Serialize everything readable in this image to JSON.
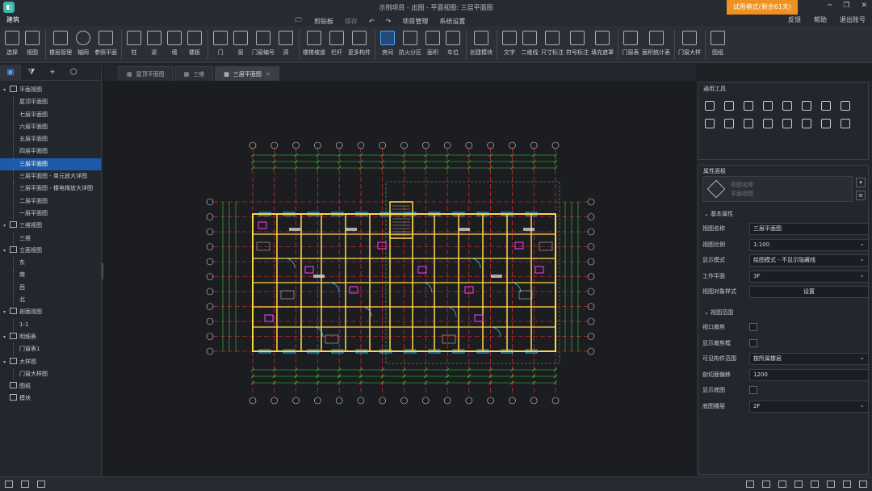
{
  "window": {
    "title": "示例项目 - 出图 - 平面视图: 三层平面图",
    "trial_label": "试用模式(剩余61天)",
    "minimize_glyph": "─",
    "maximize_glyph": "❐",
    "close_glyph": "✕"
  },
  "menu": {
    "module_tab": "建筑",
    "clipboard": "剪贴板",
    "save": "保存",
    "undo_glyph": "↶",
    "redo_glyph": "↷",
    "project_manage": "项目管理",
    "system_settings": "系统设置",
    "feedback": "反馈",
    "help": "帮助",
    "logout": "退出账号"
  },
  "ribbon": [
    {
      "label": "选择",
      "icon": "select-icon"
    },
    {
      "label": "视图",
      "icon": "view-icon"
    },
    {
      "label": "楼层管理",
      "icon": "floor-manage-icon"
    },
    {
      "label": "轴网",
      "icon": "axis-grid-icon"
    },
    {
      "label": "参照平面",
      "icon": "reference-plane-icon"
    },
    {
      "label": "柱",
      "icon": "column-icon"
    },
    {
      "label": "梁",
      "icon": "beam-icon"
    },
    {
      "label": "墙",
      "icon": "wall-icon"
    },
    {
      "label": "楼板",
      "icon": "slab-icon"
    },
    {
      "label": "门",
      "icon": "door-icon"
    },
    {
      "label": "窗",
      "icon": "window-icon"
    },
    {
      "label": "门窗编号",
      "icon": "door-window-number-icon"
    },
    {
      "label": "洞",
      "icon": "opening-icon"
    },
    {
      "label": "楼梯坡道",
      "icon": "stair-ramp-icon"
    },
    {
      "label": "栏杆",
      "icon": "railing-icon"
    },
    {
      "label": "更多构件",
      "icon": "more-components-icon"
    },
    {
      "label": "房间",
      "icon": "room-icon"
    },
    {
      "label": "防火分区",
      "icon": "fire-zone-icon"
    },
    {
      "label": "面积",
      "icon": "area-icon"
    },
    {
      "label": "车位",
      "icon": "parking-icon"
    },
    {
      "label": "创建模块",
      "icon": "create-module-icon"
    },
    {
      "label": "文字",
      "icon": "text-icon"
    },
    {
      "label": "二维线",
      "icon": "line-2d-icon"
    },
    {
      "label": "尺寸标注",
      "icon": "dimension-icon"
    },
    {
      "label": "符号标注",
      "icon": "symbol-icon"
    },
    {
      "label": "填充遮罩",
      "icon": "fill-mask-icon"
    },
    {
      "label": "门窗表",
      "icon": "door-window-table-icon"
    },
    {
      "label": "面积统计表",
      "icon": "area-table-icon"
    },
    {
      "label": "门窗大样",
      "icon": "door-window-detail-icon"
    },
    {
      "label": "图纸",
      "icon": "drawing-icon"
    }
  ],
  "left_panel": {
    "tree": [
      {
        "label": "平面视图",
        "level": 0,
        "expanded": true
      },
      {
        "label": "屋顶平面图",
        "level": 1
      },
      {
        "label": "七层平面图",
        "level": 1
      },
      {
        "label": "六层平面图",
        "level": 1
      },
      {
        "label": "五层平面图",
        "level": 1
      },
      {
        "label": "四层平面图",
        "level": 1
      },
      {
        "label": "三层平面图",
        "level": 1,
        "selected": true
      },
      {
        "label": "三层平面图 - 单元放大详图",
        "level": 1
      },
      {
        "label": "三层平面图 - 楼电梯放大详图",
        "level": 1
      },
      {
        "label": "二层平面图",
        "level": 1
      },
      {
        "label": "一层平面图",
        "level": 1
      },
      {
        "label": "三维视图",
        "level": 0,
        "expanded": true
      },
      {
        "label": "三维",
        "level": 1
      },
      {
        "label": "立面视图",
        "level": 0,
        "expanded": true
      },
      {
        "label": "东",
        "level": 1
      },
      {
        "label": "南",
        "level": 1
      },
      {
        "label": "西",
        "level": 1
      },
      {
        "label": "北",
        "level": 1
      },
      {
        "label": "剖面视图",
        "level": 0,
        "expanded": true
      },
      {
        "label": "1-1",
        "level": 1
      },
      {
        "label": "明细表",
        "level": 0,
        "expanded": true
      },
      {
        "label": "门窗表1",
        "level": 1
      },
      {
        "label": "大样图",
        "level": 0,
        "expanded": true
      },
      {
        "label": "门窗大样图",
        "level": 1
      },
      {
        "label": "图纸",
        "level": 0
      },
      {
        "label": "模块",
        "level": 0
      }
    ]
  },
  "doc_tabs": [
    {
      "label": "屋顶平面图",
      "active": false
    },
    {
      "label": "三维",
      "active": false
    },
    {
      "label": "三层平面图",
      "active": true
    }
  ],
  "tools_panel": {
    "title": "通用工具"
  },
  "props": {
    "title": "属性面板",
    "placeholder_name": "视图名称",
    "placeholder_type": "平面视图",
    "group_basic": "基本属性",
    "group_range": "视图范围",
    "rows_basic": [
      {
        "k": "视图名称",
        "v": "三层平面图",
        "type": "text"
      },
      {
        "k": "视图比例",
        "v": "1:100",
        "type": "dd"
      },
      {
        "k": "显示模式",
        "v": "绘图模式 - 不显示隐藏线",
        "type": "dd"
      },
      {
        "k": "工作平面",
        "v": "3F",
        "type": "dd"
      },
      {
        "k": "视图对象样式",
        "v": "设置",
        "type": "btn"
      }
    ],
    "rows_range": [
      {
        "k": "视口裁剪",
        "type": "chk"
      },
      {
        "k": "显示裁剪框",
        "type": "chk"
      },
      {
        "k": "可见构件范围",
        "v": "按所属楼层",
        "type": "dd"
      },
      {
        "k": "剖切面偏移",
        "v": "1200",
        "type": "text"
      },
      {
        "k": "显示底图",
        "type": "chk"
      },
      {
        "k": "底图楼层",
        "v": "2F",
        "type": "dd"
      }
    ]
  },
  "colors": {
    "accent": "#1e5aa8",
    "trial": "#f0901e",
    "cad_wall": "#ffd84a",
    "cad_axis": "#ff3030",
    "cad_dim": "#36d43a",
    "cad_fixture": "#ff3cff",
    "cad_window": "#47d6ff"
  }
}
